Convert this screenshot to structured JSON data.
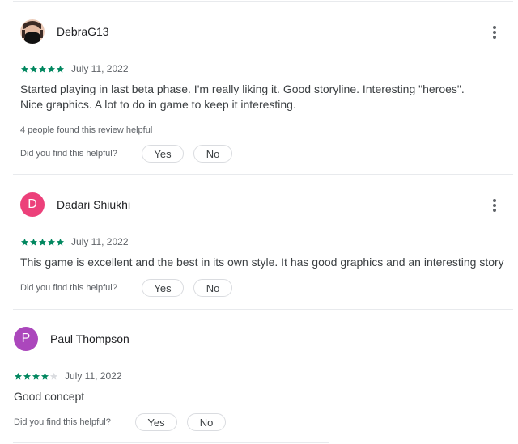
{
  "reviews": [
    {
      "author": "DebraG13",
      "avatar_letter": "",
      "avatar_color": "#f3d8c8",
      "rating": 5,
      "date": "July 11, 2022",
      "text": "Started playing in last beta phase. I'm really liking it. Good storyline. Interesting \"heroes\". Nice graphics. A lot to do in game to keep it interesting.",
      "helpful_count_text": "4 people found this review helpful",
      "helpful_question": "Did you find this helpful?",
      "yes_label": "Yes",
      "no_label": "No"
    },
    {
      "author": "Dadari Shiukhi",
      "avatar_letter": "D",
      "avatar_color": "#ec407a",
      "rating": 5,
      "date": "July 11, 2022",
      "text": "This game is excellent and the best in its own style. It has good graphics and an interesting story",
      "helpful_question": "Did you find this helpful?",
      "yes_label": "Yes",
      "no_label": "No"
    },
    {
      "author": "Paul Thompson",
      "avatar_letter": "P",
      "avatar_color": "#ab47bc",
      "rating": 4,
      "date": "July 11, 2022",
      "text": "Good concept",
      "helpful_question": "Did you find this helpful?",
      "yes_label": "Yes",
      "no_label": "No"
    }
  ],
  "colors": {
    "star_filled": "#01875f",
    "star_empty": "#dadce0"
  }
}
